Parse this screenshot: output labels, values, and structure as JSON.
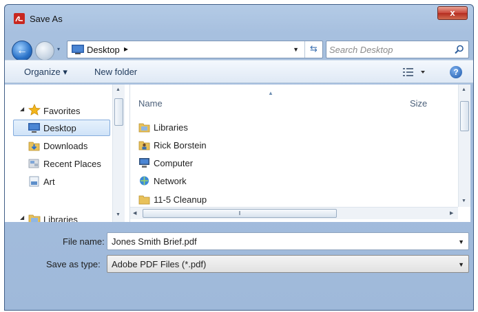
{
  "window": {
    "title": "Save As",
    "close_label": "x"
  },
  "address": {
    "location": "Desktop",
    "chevron": "▸"
  },
  "search": {
    "placeholder": "Search Desktop"
  },
  "toolbar": {
    "organize_label": "Organize ▾",
    "new_folder_label": "New folder",
    "help_label": "?"
  },
  "nav": {
    "favorites_label": "Favorites",
    "items": [
      {
        "label": "Desktop",
        "icon": "desktop-icon",
        "selected": true
      },
      {
        "label": "Downloads",
        "icon": "downloads-icon"
      },
      {
        "label": "Recent Places",
        "icon": "recent-places-icon"
      },
      {
        "label": "Art",
        "icon": "art-icon"
      }
    ],
    "libraries_label": "Libraries"
  },
  "files": {
    "columns": {
      "name": "Name",
      "size": "Size"
    },
    "rows": [
      {
        "name": "Libraries",
        "icon": "libraries-icon"
      },
      {
        "name": "Rick Borstein",
        "icon": "user-folder-icon"
      },
      {
        "name": "Computer",
        "icon": "computer-icon"
      },
      {
        "name": "Network",
        "icon": "network-icon"
      },
      {
        "name": "11-5 Cleanup",
        "icon": "folder-icon"
      }
    ]
  },
  "form": {
    "file_name_label": "File name:",
    "file_name_value": "Jones Smith Brief.pdf",
    "save_type_label": "Save as type:",
    "save_type_value": "Adobe PDF Files (*.pdf)"
  },
  "colors": {
    "title_bar": "#a7c0df",
    "selection": "#cfe3f8",
    "close_button": "#c9473a",
    "folder_yellow": "#e8c15a"
  }
}
